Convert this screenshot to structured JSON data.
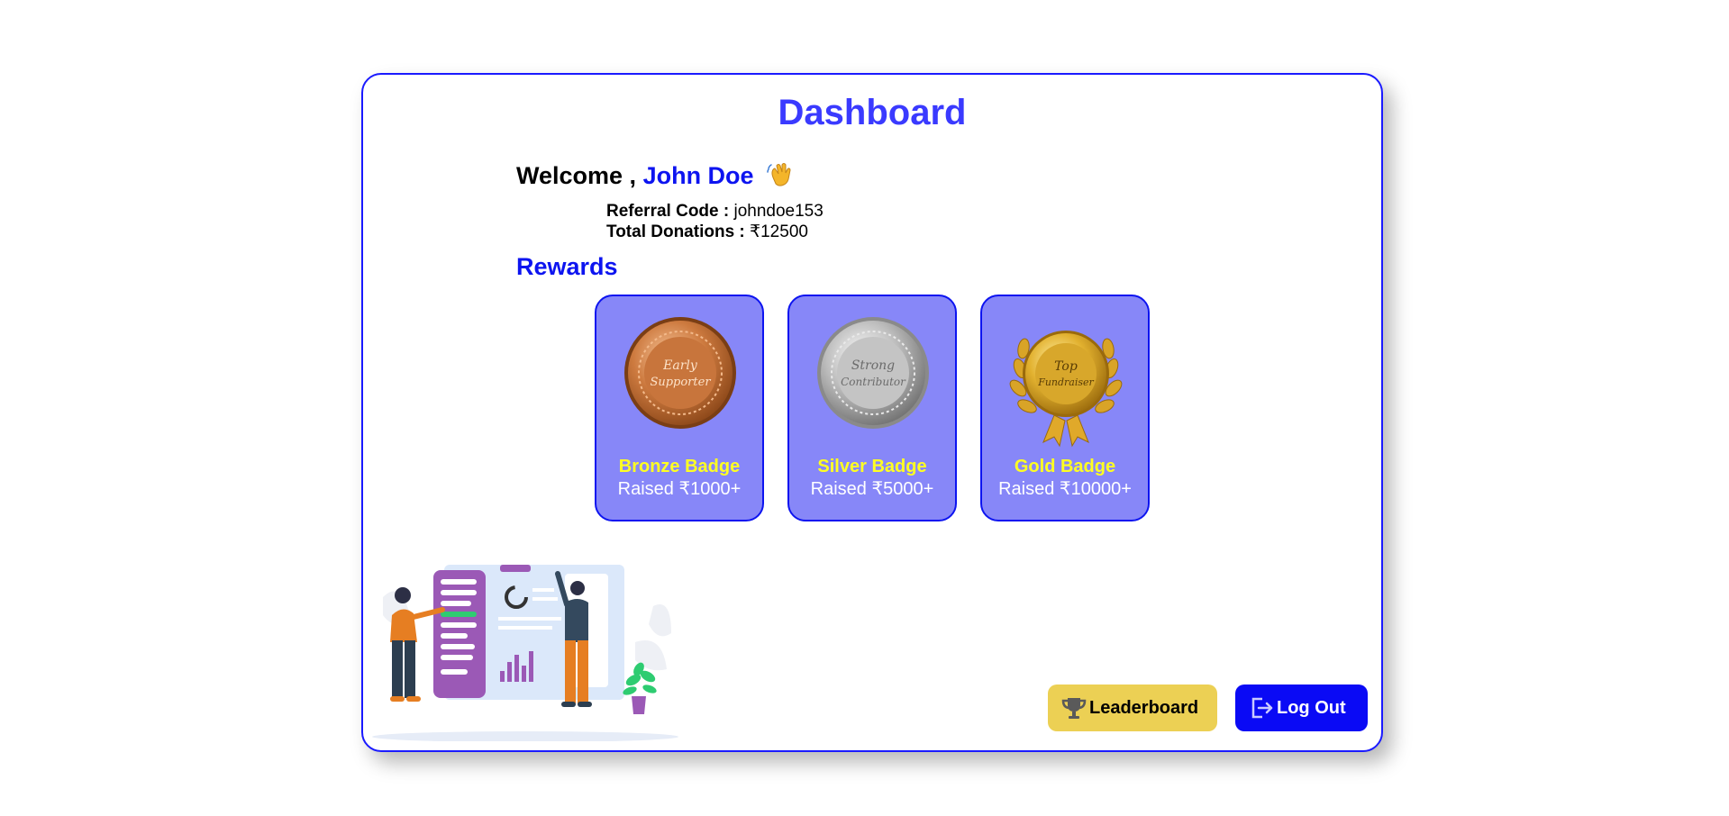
{
  "dashboard": {
    "title": "Dashboard",
    "welcome_prefix": "Welcome , ",
    "user_name": "John Doe",
    "referral_label": "Referral Code :",
    "referral_code": "johndoe153",
    "donations_label": "Total Donations :",
    "total_donations": "₹12500"
  },
  "rewards": {
    "title": "Rewards",
    "badges": [
      {
        "name": "Bronze Badge",
        "requirement": "Raised ₹1000+",
        "medal_text": [
          "Early",
          "Supporter"
        ],
        "icon": "bronze-medal-icon"
      },
      {
        "name": "Silver Badge",
        "requirement": "Raised ₹5000+",
        "medal_text": [
          "Strong",
          "Contributor"
        ],
        "icon": "silver-medal-icon"
      },
      {
        "name": "Gold Badge",
        "requirement": "Raised ₹10000+",
        "medal_text": [
          "Top",
          "Fundraiser"
        ],
        "icon": "gold-medal-icon"
      }
    ]
  },
  "actions": {
    "leaderboard_label": "Leaderboard",
    "logout_label": "Log Out"
  },
  "colors": {
    "accent_blue": "#0d14f0",
    "badge_bg": "#8787f8",
    "badge_title": "#ffff22",
    "leaderboard_bg": "#ecd054",
    "logout_bg": "#0a0af5"
  }
}
